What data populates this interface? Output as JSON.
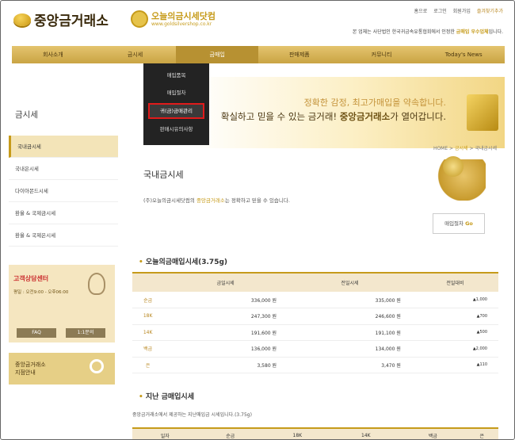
{
  "header": {
    "logo": "중앙금거래소",
    "brand_name": "오늘의금시세닷컴",
    "brand_url": "www.goldsilvershop.co.kr",
    "top_links": [
      "홈으로",
      "로그인",
      "회원가입",
      "즐겨찾기추가"
    ],
    "notice_prefix": "본 업체는 사단법인 한국귀금속유통협회에서 인정한 ",
    "notice_highlight": "금매입 우수업체",
    "notice_suffix": "입니다."
  },
  "nav": {
    "items": [
      "회사소개",
      "금시세",
      "금매입",
      "판매제품",
      "커뮤니티",
      "Today's News"
    ],
    "active": 2
  },
  "submenu": [
    "매입품목",
    "매입절차",
    "귀(금)금매관리",
    "판매시유의사항"
  ],
  "banner": {
    "line1": "정확한 감정, 최고가매입을 약속합니다.",
    "line2_prefix": "확실하고 믿을 수 있는 금거래! ",
    "line2_bold": "중앙금거래소",
    "line2_suffix": "가 열어갑니다."
  },
  "sidebar": {
    "title": "금시세",
    "items": [
      "국내금시세",
      "국내은시세",
      "다이아몬드시세",
      "환율 & 국제금시세",
      "환율 & 국제은시세"
    ],
    "active": 0
  },
  "cs": {
    "title": "고객상담센터",
    "hours": "평일 : 오전9:00 - 오후06:00",
    "faq": "FAQ",
    "qna": "1:1문의"
  },
  "store": {
    "line1": "중앙금거래소",
    "line2": "지점안내"
  },
  "breadcrumb": {
    "home": "HOME",
    "sep": " > ",
    "mid": "금시세",
    "current": "국내금시세"
  },
  "page": {
    "title": "국내금시세",
    "desc_prefix": "(주)오늘의금시세닷컴의 ",
    "desc_highlight": "중앙금거래소",
    "desc_suffix": "는 정확하고 믿을 수 있습니다.",
    "button_label": "매입절차",
    "button_go": "Go"
  },
  "today": {
    "title": "오늘의금매입시세(3.75g)",
    "headers": [
      "",
      "금일시세",
      "전일시세",
      "전일대비"
    ],
    "rows": [
      [
        "순금",
        "336,000 원",
        "335,000 원",
        "▲1,000"
      ],
      [
        "18K",
        "247,300 원",
        "246,600 원",
        "▲700"
      ],
      [
        "14K",
        "191,600 원",
        "191,100 원",
        "▲500"
      ],
      [
        "백금",
        "136,000 원",
        "134,000 원",
        "▲2,000"
      ],
      [
        "은",
        "3,580 원",
        "3,470 원",
        "▲110"
      ]
    ]
  },
  "past": {
    "title": "지난 금매입시세",
    "desc": "중앙금거래소에서 제공하는 지난매입금 시세입니다.(3.75g)",
    "headers": [
      "일자",
      "순금",
      "18K",
      "14K",
      "백금",
      "은"
    ]
  }
}
